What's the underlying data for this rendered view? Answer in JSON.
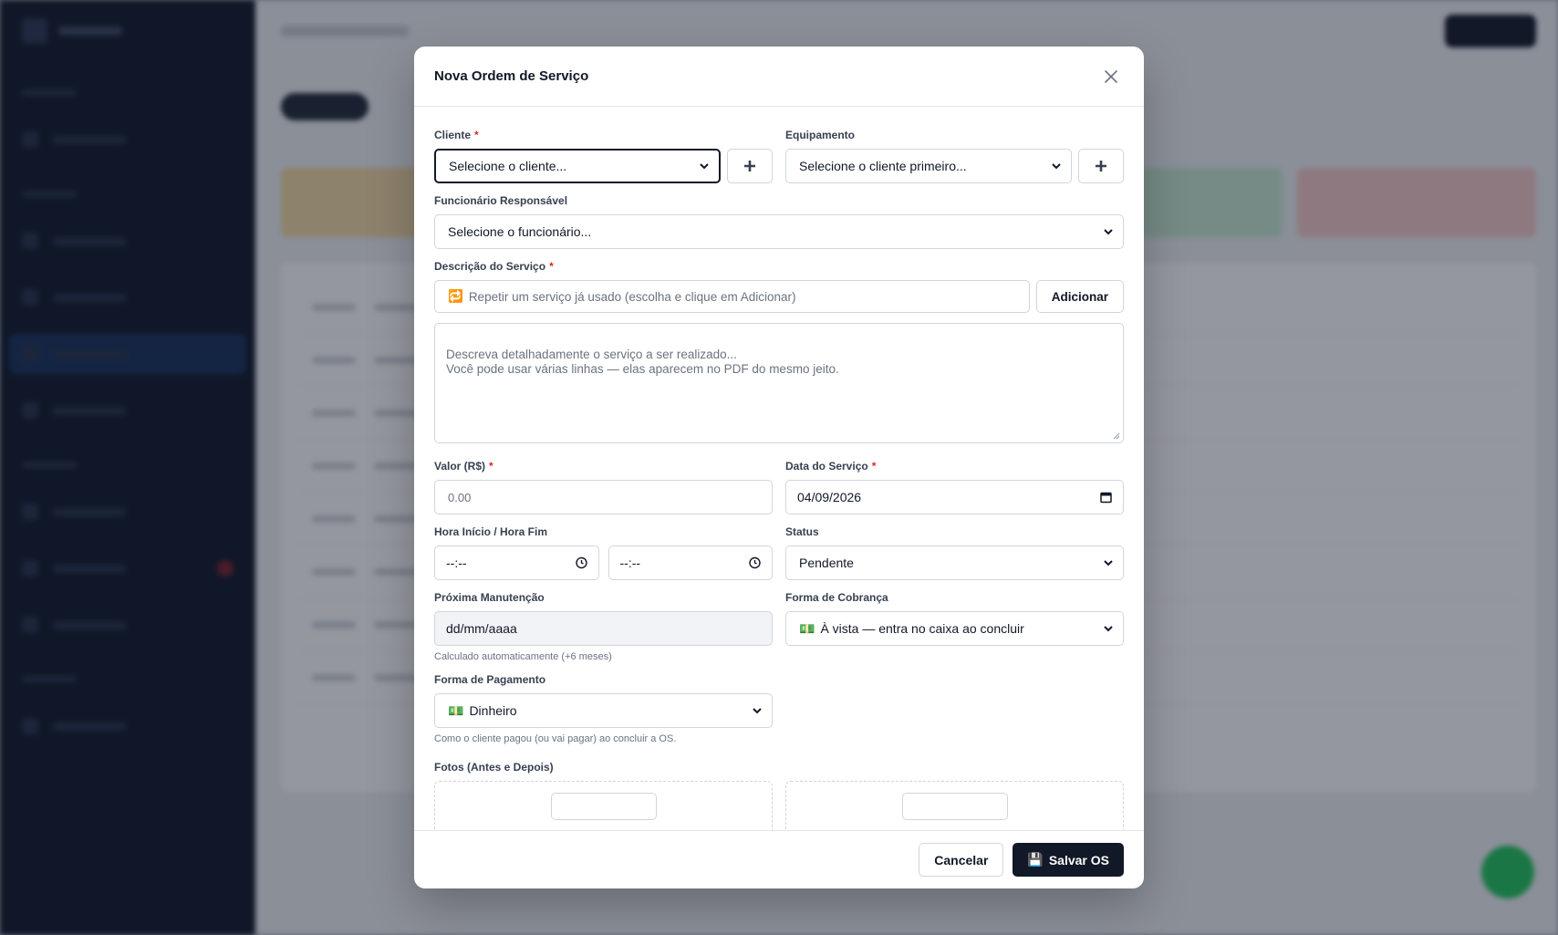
{
  "modal": {
    "title": "Nova Ordem de Serviço",
    "cliente": {
      "label": "Cliente",
      "required_mark": "*",
      "value": "Selecione o cliente..."
    },
    "equipamento": {
      "label": "Equipamento",
      "value": "Selecione o cliente primeiro..."
    },
    "funcionario": {
      "label": "Funcionário Responsável",
      "value": "Selecione o funcionário..."
    },
    "descricao": {
      "label": "Descrição do Serviço",
      "required_mark": "*",
      "repeat_icon": "🔁",
      "repeat_placeholder": "Repetir um serviço já usado (escolha e clique em Adicionar)",
      "add_label": "Adicionar",
      "textarea_placeholder": "Descreva detalhadamente o serviço a ser realizado...\nVocê pode usar várias linhas — elas aparecem no PDF do mesmo jeito."
    },
    "valor": {
      "label": "Valor (R$)",
      "required_mark": "*",
      "placeholder": "0.00"
    },
    "data": {
      "label": "Data do Serviço",
      "required_mark": "*",
      "value": "04/09/2026"
    },
    "hora": {
      "label": "Hora Início / Hora Fim",
      "inicio": "--:--",
      "fim": "--:--"
    },
    "status": {
      "label": "Status",
      "value": "Pendente"
    },
    "proxima": {
      "label": "Próxima Manutenção",
      "value": "dd/mm/aaaa",
      "hint": "Calculado automaticamente (+6 meses)"
    },
    "cobranca": {
      "label": "Forma de Cobrança",
      "icon": "💵",
      "value": "À vista — entra no caixa ao concluir"
    },
    "pagamento": {
      "label": "Forma de Pagamento",
      "icon": "💵",
      "value": "Dinheiro",
      "hint": "Como o cliente pagou (ou vai pagar) ao concluir a OS."
    },
    "fotos": {
      "label": "Fotos (Antes e Depois)"
    },
    "footer": {
      "cancel_label": "Cancelar",
      "save_icon": "💾",
      "save_label": "Salvar OS"
    }
  },
  "colors": {
    "primary": "#111827",
    "required": "#dc2626",
    "border": "#d1d5db"
  }
}
